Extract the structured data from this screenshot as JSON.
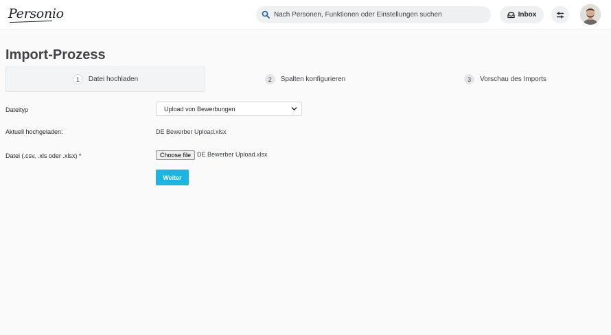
{
  "app": {
    "logo_text": "Personio"
  },
  "header": {
    "search_placeholder": "Nach Personen, Funktionen oder Einstellungen suchen",
    "inbox_label": "Inbox"
  },
  "page": {
    "title": "Import-Prozess"
  },
  "steps": [
    {
      "number": "1",
      "label": "Datei hochladen",
      "active": true
    },
    {
      "number": "2",
      "label": "Spalten konfigurieren",
      "active": false
    },
    {
      "number": "3",
      "label": "Vorschau des Imports",
      "active": false
    }
  ],
  "form": {
    "file_type_label": "Dateityp",
    "file_type_value": "Upload von Bewerbungen",
    "current_upload_label": "Aktuell hochgeladen:",
    "current_upload_value": "DE Bewerber Upload.xlsx",
    "file_label": "Datei (.csv, .xls oder .xlsx) *",
    "choose_file_label": "Choose file",
    "chosen_file_name": "DE Bewerber Upload.xlsx",
    "submit_label": "Weiter"
  },
  "colors": {
    "accent": "#1cb4e0",
    "background": "#fafafa",
    "header": "#ffffff"
  },
  "icons": {
    "search": "search-icon",
    "inbox": "inbox-icon",
    "filter": "filter-icon",
    "chevron": "chevron-down-icon"
  }
}
